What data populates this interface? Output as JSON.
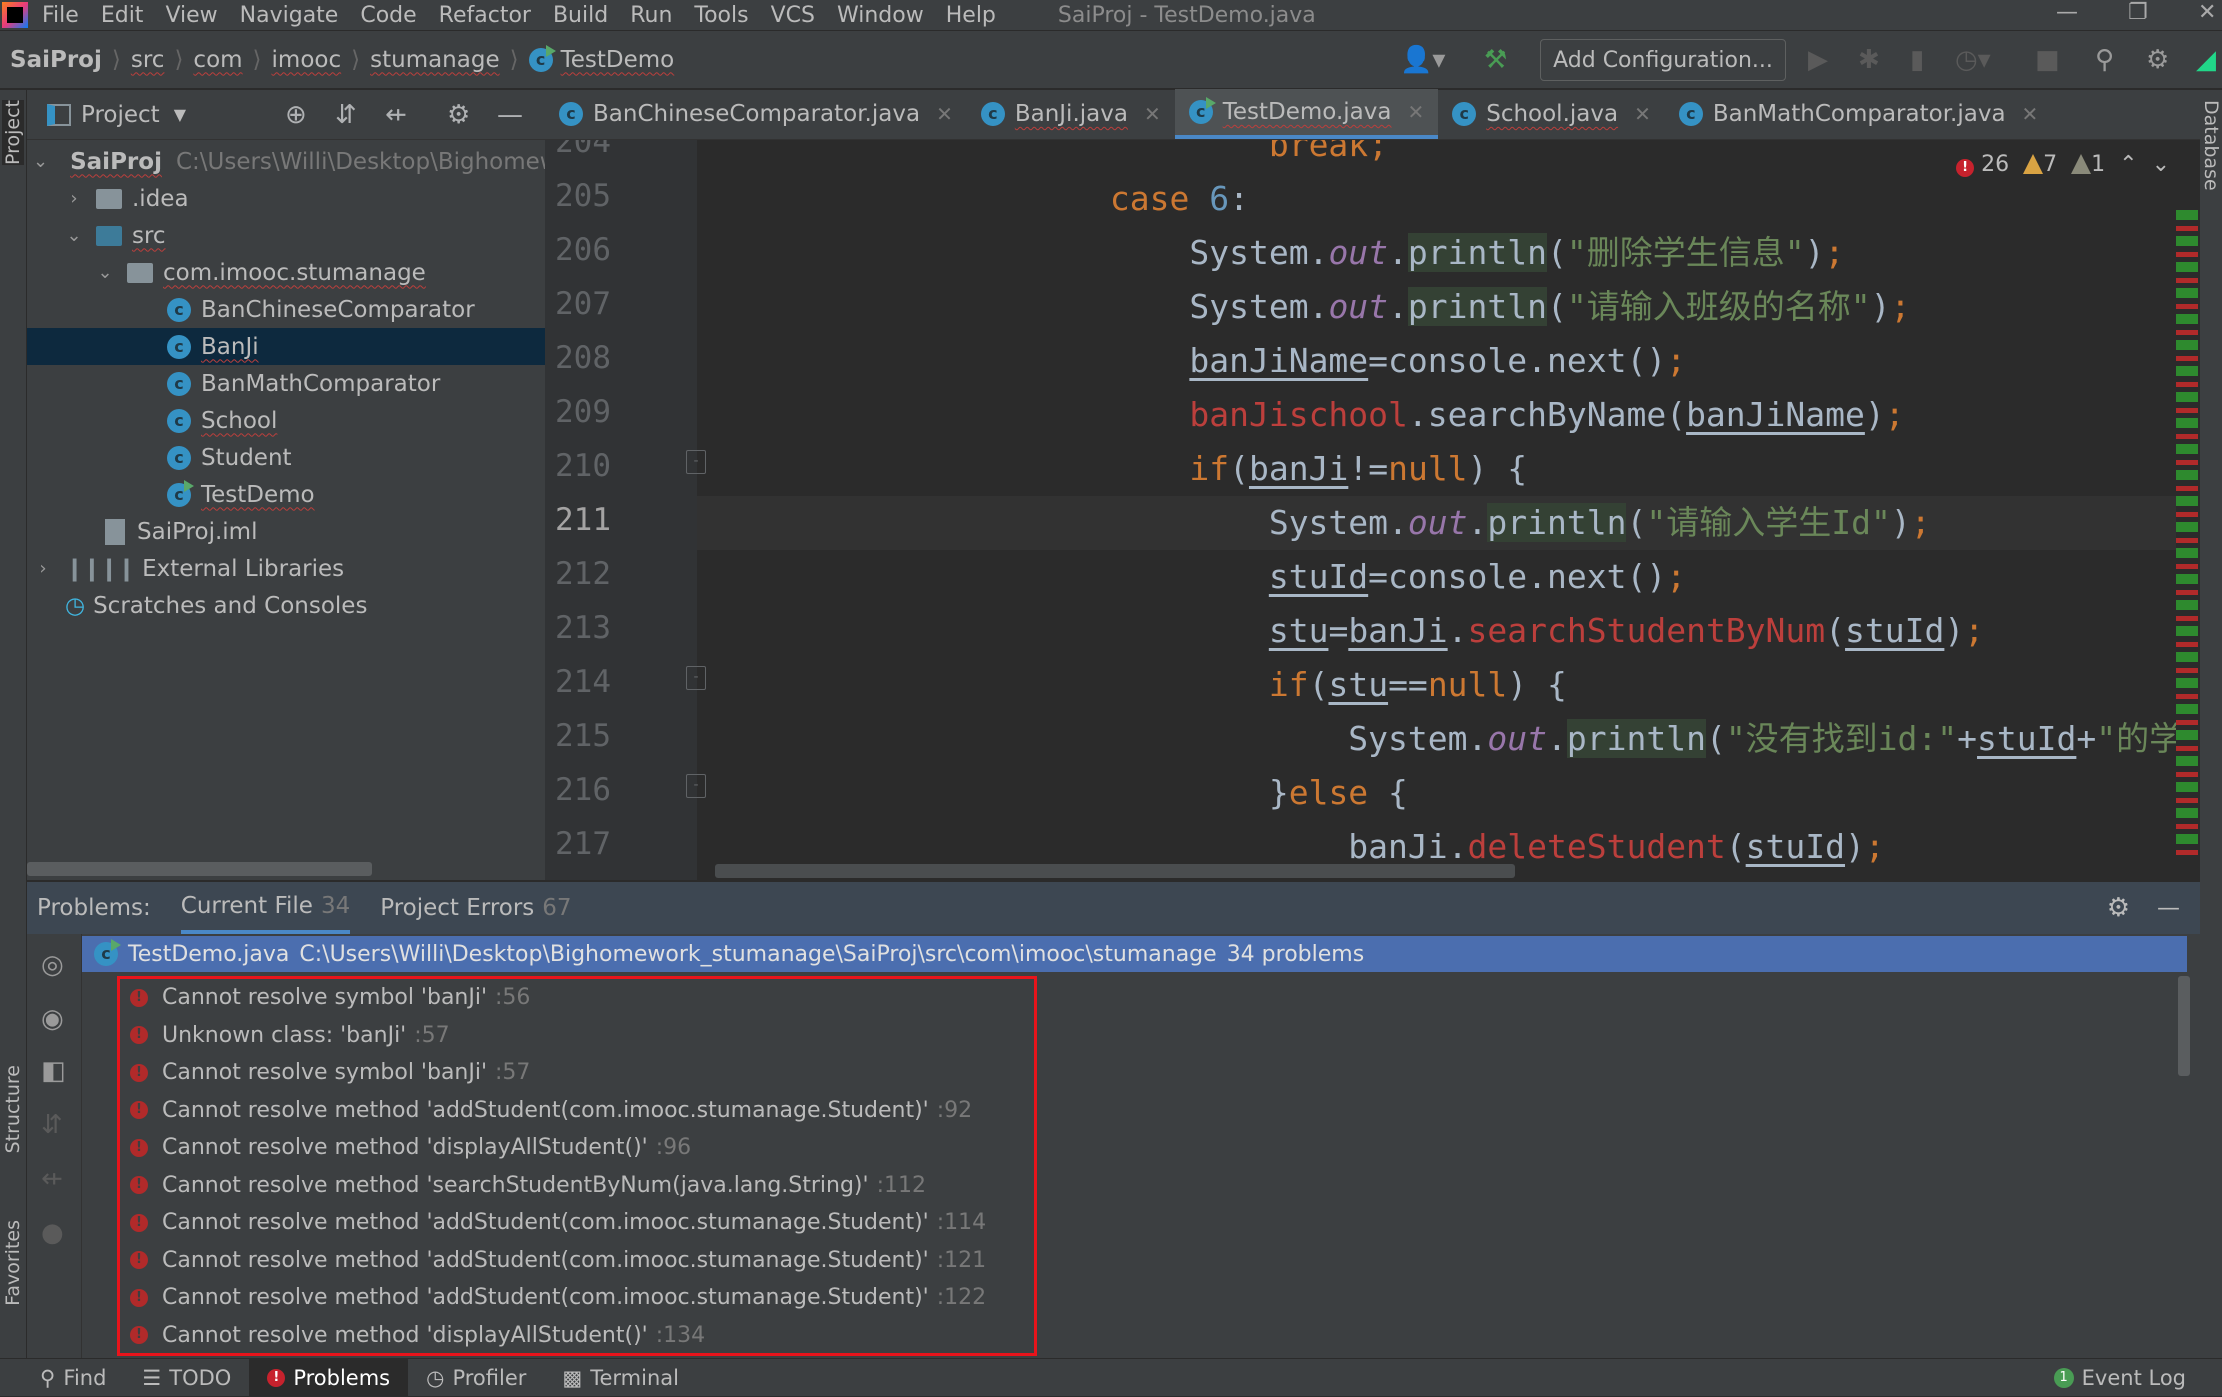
{
  "menubar": {
    "items": [
      "File",
      "Edit",
      "View",
      "Navigate",
      "Code",
      "Refactor",
      "Build",
      "Run",
      "Tools",
      "VCS",
      "Window",
      "Help"
    ],
    "title": "SaiProj - TestDemo.java"
  },
  "breadcrumb": [
    "SaiProj",
    "src",
    "com",
    "imooc",
    "stumanage",
    "TestDemo"
  ],
  "toolbar": {
    "add_configuration": "Add Configuration..."
  },
  "project_panel": {
    "title": "Project",
    "tree": [
      {
        "label": "SaiProj",
        "hint": "C:\\Users\\Willi\\Desktop\\Bighomework_stumanage",
        "expanded": true
      },
      {
        "label": ".idea",
        "expanded": false
      },
      {
        "label": "src",
        "expanded": true
      },
      {
        "label": "com.imooc.stumanage",
        "expanded": true
      },
      {
        "label": "BanChineseComparator"
      },
      {
        "label": "BanJi",
        "selected": true
      },
      {
        "label": "BanMathComparator"
      },
      {
        "label": "School"
      },
      {
        "label": "Student"
      },
      {
        "label": "TestDemo"
      },
      {
        "label": "SaiProj.iml"
      },
      {
        "label": "External Libraries",
        "expanded": false
      },
      {
        "label": "Scratches and Consoles"
      }
    ]
  },
  "side_labels": {
    "project": "Project",
    "structure": "Structure",
    "favorites": "Favorites",
    "database": "Database"
  },
  "editor": {
    "tabs": [
      {
        "label": "BanChineseComparator.java"
      },
      {
        "label": "BanJi.java"
      },
      {
        "label": "TestDemo.java",
        "active": true
      },
      {
        "label": "School.java"
      },
      {
        "label": "BanMathComparator.java"
      }
    ],
    "inspection": {
      "errors": "26",
      "warnings": "7",
      "weak_warnings": "1"
    },
    "current_line": 211,
    "lines": [
      {
        "n": "204",
        "tokens": [
          {
            "t": "                        "
          },
          {
            "t": "break",
            "c": "kw"
          },
          {
            "t": ";",
            "c": "semi"
          }
        ]
      },
      {
        "n": "205",
        "tokens": [
          {
            "t": "                "
          },
          {
            "t": "case ",
            "c": "kw"
          },
          {
            "t": "6",
            "c": "num"
          },
          {
            "t": ":"
          }
        ]
      },
      {
        "n": "206",
        "tokens": [
          {
            "t": "                    System."
          },
          {
            "t": "out",
            "c": "fld"
          },
          {
            "t": "."
          },
          {
            "t": "println",
            "c": "mhl"
          },
          {
            "t": "("
          },
          {
            "t": "\"删除学生信息\"",
            "c": "str"
          },
          {
            "t": ")"
          },
          {
            "t": ";",
            "c": "semi"
          }
        ]
      },
      {
        "n": "207",
        "tokens": [
          {
            "t": "                    System."
          },
          {
            "t": "out",
            "c": "fld"
          },
          {
            "t": "."
          },
          {
            "t": "println",
            "c": "mhl"
          },
          {
            "t": "("
          },
          {
            "t": "\"请输入班级的名称\"",
            "c": "str"
          },
          {
            "t": ")"
          },
          {
            "t": ";",
            "c": "semi"
          }
        ]
      },
      {
        "n": "208",
        "tokens": [
          {
            "t": "                    "
          },
          {
            "t": "banJiName",
            "c": "loc"
          },
          {
            "t": "=console.next()"
          },
          {
            "t": ";",
            "c": "semi"
          }
        ]
      },
      {
        "n": "209",
        "tokens": [
          {
            "t": "                    "
          },
          {
            "t": "banJischool",
            "c": "err"
          },
          {
            "t": ".searchByName("
          },
          {
            "t": "banJiName",
            "c": "loc"
          },
          {
            "t": ")"
          },
          {
            "t": ";",
            "c": "semi"
          }
        ]
      },
      {
        "n": "210",
        "tokens": [
          {
            "t": "                    "
          },
          {
            "t": "if",
            "c": "kw"
          },
          {
            "t": "("
          },
          {
            "t": "banJi",
            "c": "loc"
          },
          {
            "t": "!="
          },
          {
            "t": "null",
            "c": "kw"
          },
          {
            "t": ") {"
          }
        ]
      },
      {
        "n": "211",
        "tokens": [
          {
            "t": "                        System."
          },
          {
            "t": "out",
            "c": "fld"
          },
          {
            "t": "."
          },
          {
            "t": "println",
            "c": "mhl"
          },
          {
            "t": "("
          },
          {
            "t": "\"请输入学生Id\"",
            "c": "str"
          },
          {
            "t": ")"
          },
          {
            "t": ";",
            "c": "semi"
          }
        ]
      },
      {
        "n": "212",
        "tokens": [
          {
            "t": "                        "
          },
          {
            "t": "stuId",
            "c": "loc"
          },
          {
            "t": "=console.next()"
          },
          {
            "t": ";",
            "c": "semi"
          }
        ]
      },
      {
        "n": "213",
        "tokens": [
          {
            "t": "                        "
          },
          {
            "t": "stu",
            "c": "loc"
          },
          {
            "t": "="
          },
          {
            "t": "banJi",
            "c": "loc"
          },
          {
            "t": "."
          },
          {
            "t": "searchStudentByNum",
            "c": "err"
          },
          {
            "t": "("
          },
          {
            "t": "stuId",
            "c": "loc"
          },
          {
            "t": ")"
          },
          {
            "t": ";",
            "c": "semi"
          }
        ]
      },
      {
        "n": "214",
        "tokens": [
          {
            "t": "                        "
          },
          {
            "t": "if",
            "c": "kw"
          },
          {
            "t": "("
          },
          {
            "t": "stu",
            "c": "loc"
          },
          {
            "t": "=="
          },
          {
            "t": "null",
            "c": "kw"
          },
          {
            "t": ") {"
          }
        ]
      },
      {
        "n": "215",
        "tokens": [
          {
            "t": "                            System."
          },
          {
            "t": "out",
            "c": "fld"
          },
          {
            "t": "."
          },
          {
            "t": "println",
            "c": "mhl"
          },
          {
            "t": "("
          },
          {
            "t": "\"没有找到id:\"",
            "c": "str"
          },
          {
            "t": "+"
          },
          {
            "t": "stuId",
            "c": "loc"
          },
          {
            "t": "+"
          },
          {
            "t": "\"的学",
            "c": "str"
          }
        ]
      },
      {
        "n": "216",
        "tokens": [
          {
            "t": "                        }"
          },
          {
            "t": "else",
            "c": "kw"
          },
          {
            "t": " {"
          }
        ]
      },
      {
        "n": "217",
        "tokens": [
          {
            "t": "                            "
          },
          {
            "t": "banJi",
            "c": "loc"
          },
          {
            "t": "."
          },
          {
            "t": "deleteStudent",
            "c": "err"
          },
          {
            "t": "("
          },
          {
            "t": "stuId",
            "c": "loc"
          },
          {
            "t": ")"
          },
          {
            "t": ";",
            "c": "semi"
          }
        ]
      }
    ]
  },
  "problems": {
    "label": "Problems:",
    "tabs": [
      {
        "label": "Current File",
        "count": "34",
        "active": true
      },
      {
        "label": "Project Errors",
        "count": "67"
      }
    ],
    "file": {
      "name": "TestDemo.java",
      "path": "C:\\Users\\Willi\\Desktop\\Bighomework_stumanage\\SaiProj\\src\\com\\imooc\\stumanage",
      "summary": "34 problems"
    },
    "items": [
      {
        "text": "Cannot resolve symbol 'banJi'",
        "line": ":56"
      },
      {
        "text": "Unknown class: 'banJi'",
        "line": ":57"
      },
      {
        "text": "Cannot resolve symbol 'banJi'",
        "line": ":57"
      },
      {
        "text": "Cannot resolve method 'addStudent(com.imooc.stumanage.Student)'",
        "line": ":92"
      },
      {
        "text": "Cannot resolve method 'displayAllStudent()'",
        "line": ":96"
      },
      {
        "text": "Cannot resolve method 'searchStudentByNum(java.lang.String)'",
        "line": ":112"
      },
      {
        "text": "Cannot resolve method 'addStudent(com.imooc.stumanage.Student)'",
        "line": ":114"
      },
      {
        "text": "Cannot resolve method 'addStudent(com.imooc.stumanage.Student)'",
        "line": ":121"
      },
      {
        "text": "Cannot resolve method 'addStudent(com.imooc.stumanage.Student)'",
        "line": ":122"
      },
      {
        "text": "Cannot resolve method 'displayAllStudent()'",
        "line": ":134"
      }
    ]
  },
  "statusbar": {
    "items": [
      {
        "label": "Find",
        "icon": "search-icon"
      },
      {
        "label": "TODO",
        "icon": "list-icon"
      },
      {
        "label": "Problems",
        "icon": "error-icon",
        "active": true
      },
      {
        "label": "Profiler",
        "icon": "profiler-icon"
      },
      {
        "label": "Terminal",
        "icon": "terminal-icon"
      }
    ],
    "event_log": {
      "label": "Event Log",
      "count": "1"
    }
  },
  "colors": {
    "accent": "#4a88c7",
    "selection": "#4b6eaf",
    "error": "#c7222d",
    "highlight_box": "#e8141b",
    "keyword": "#cc7832",
    "string": "#6a8759"
  }
}
